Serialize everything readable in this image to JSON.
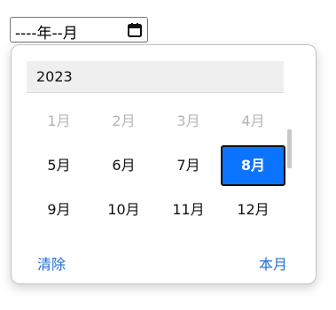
{
  "input": {
    "display_value": "----年--月",
    "icon": "calendar-icon"
  },
  "picker": {
    "year": "2023",
    "months": [
      {
        "label": "1月",
        "state": "disabled"
      },
      {
        "label": "2月",
        "state": "disabled"
      },
      {
        "label": "3月",
        "state": "disabled"
      },
      {
        "label": "4月",
        "state": "disabled"
      },
      {
        "label": "5月",
        "state": "normal"
      },
      {
        "label": "6月",
        "state": "normal"
      },
      {
        "label": "7月",
        "state": "normal"
      },
      {
        "label": "8月",
        "state": "selected"
      },
      {
        "label": "9月",
        "state": "normal"
      },
      {
        "label": "10月",
        "state": "normal"
      },
      {
        "label": "11月",
        "state": "normal"
      },
      {
        "label": "12月",
        "state": "normal"
      }
    ],
    "clear_label": "清除",
    "this_month_label": "本月"
  },
  "colors": {
    "selected_bg": "#0b74ff",
    "link": "#1f6fd0",
    "disabled_text": "#b5b5b5"
  }
}
